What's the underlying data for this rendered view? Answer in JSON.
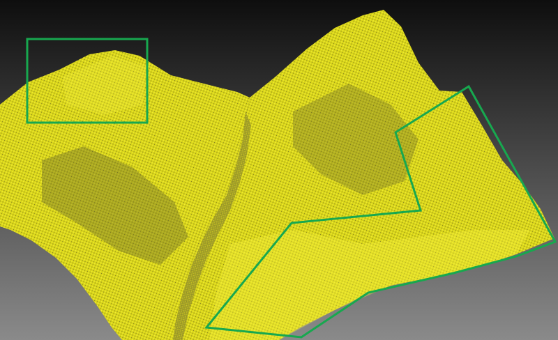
{
  "colors": {
    "background_top": "#0e0e0e",
    "background_bottom": "#8a8a8a",
    "terrain_yellow": "#e6e21a",
    "terrain_shadow": "#6f6a2a",
    "valley_dark": "#4a4a3a",
    "annotation_green": "#17a84f"
  },
  "annotations": [
    {
      "id": "rectangle-region",
      "shape": "rectangle"
    },
    {
      "id": "polygon-region",
      "shape": "polygon"
    }
  ]
}
